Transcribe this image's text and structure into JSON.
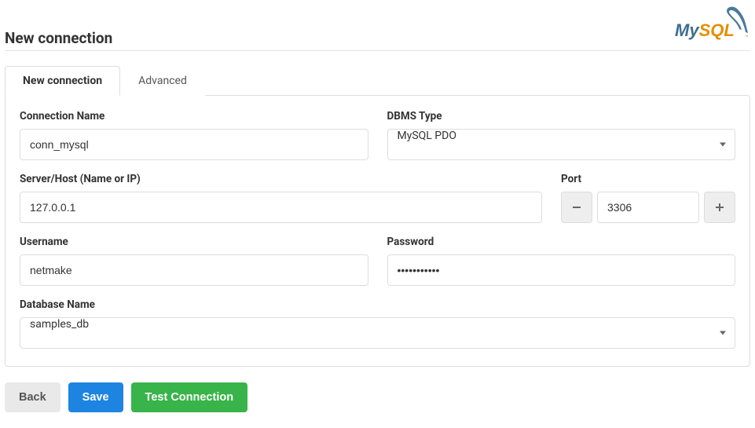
{
  "header": {
    "title": "New connection",
    "logo_text": "MySQL"
  },
  "tabs": {
    "new_connection": "New connection",
    "advanced": "Advanced"
  },
  "form": {
    "connection_name": {
      "label": "Connection Name",
      "value": "conn_mysql"
    },
    "dbms_type": {
      "label": "DBMS Type",
      "value": "MySQL PDO"
    },
    "server_host": {
      "label": "Server/Host (Name or IP)",
      "value": "127.0.0.1"
    },
    "port": {
      "label": "Port",
      "value": "3306"
    },
    "username": {
      "label": "Username",
      "value": "netmake"
    },
    "password": {
      "label": "Password",
      "value": "•••••••••••"
    },
    "database_name": {
      "label": "Database Name",
      "value": "samples_db"
    }
  },
  "buttons": {
    "back": "Back",
    "save": "Save",
    "test": "Test Connection"
  }
}
